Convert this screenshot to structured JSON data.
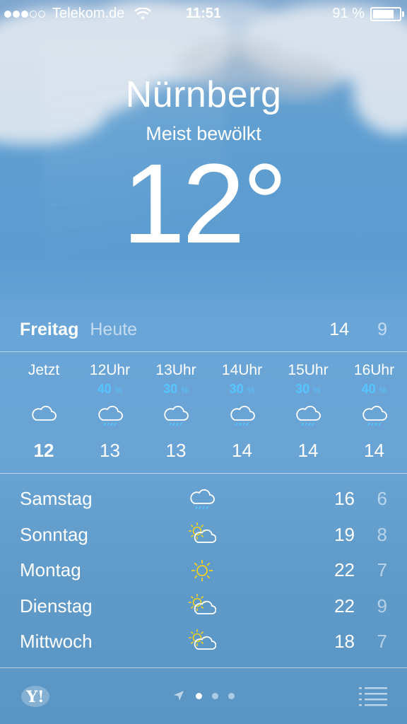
{
  "status_bar": {
    "signal_filled": 3,
    "signal_empty": 2,
    "carrier": "Telekom.de",
    "time": "11:51",
    "battery_percent_label": "91 %",
    "battery_level": 0.91
  },
  "current": {
    "city": "Nürnberg",
    "condition": "Meist bewölkt",
    "temperature": "12°"
  },
  "today": {
    "day": "Freitag",
    "label": "Heute",
    "high": "14",
    "low": "9"
  },
  "hourly": [
    {
      "time": "Jetzt",
      "pop": "",
      "icon": "cloud-icon",
      "temp": "12"
    },
    {
      "time": "12Uhr",
      "pop": "40",
      "icon": "cloud-rain-icon",
      "temp": "13"
    },
    {
      "time": "13Uhr",
      "pop": "30",
      "icon": "cloud-rain-icon",
      "temp": "13"
    },
    {
      "time": "14Uhr",
      "pop": "30",
      "icon": "cloud-rain-icon",
      "temp": "14"
    },
    {
      "time": "15Uhr",
      "pop": "30",
      "icon": "cloud-rain-icon",
      "temp": "14"
    },
    {
      "time": "16Uhr",
      "pop": "40",
      "icon": "cloud-rain-icon",
      "temp": "14"
    }
  ],
  "pop_unit": "%",
  "daily": [
    {
      "day": "Samstag",
      "icon": "cloud-rain-icon",
      "high": "16",
      "low": "6"
    },
    {
      "day": "Sonntag",
      "icon": "partly-sunny-icon",
      "high": "19",
      "low": "8"
    },
    {
      "day": "Montag",
      "icon": "sun-icon",
      "high": "22",
      "low": "7"
    },
    {
      "day": "Dienstag",
      "icon": "partly-sunny-icon",
      "high": "22",
      "low": "9"
    },
    {
      "day": "Mittwoch",
      "icon": "partly-sunny-icon",
      "high": "18",
      "low": "7"
    }
  ],
  "bottom": {
    "logo": "Y!",
    "pages": 3,
    "active_page": 0
  },
  "colors": {
    "pop_blue": "#56c4ff",
    "sun_yellow": "#f5d21d"
  }
}
